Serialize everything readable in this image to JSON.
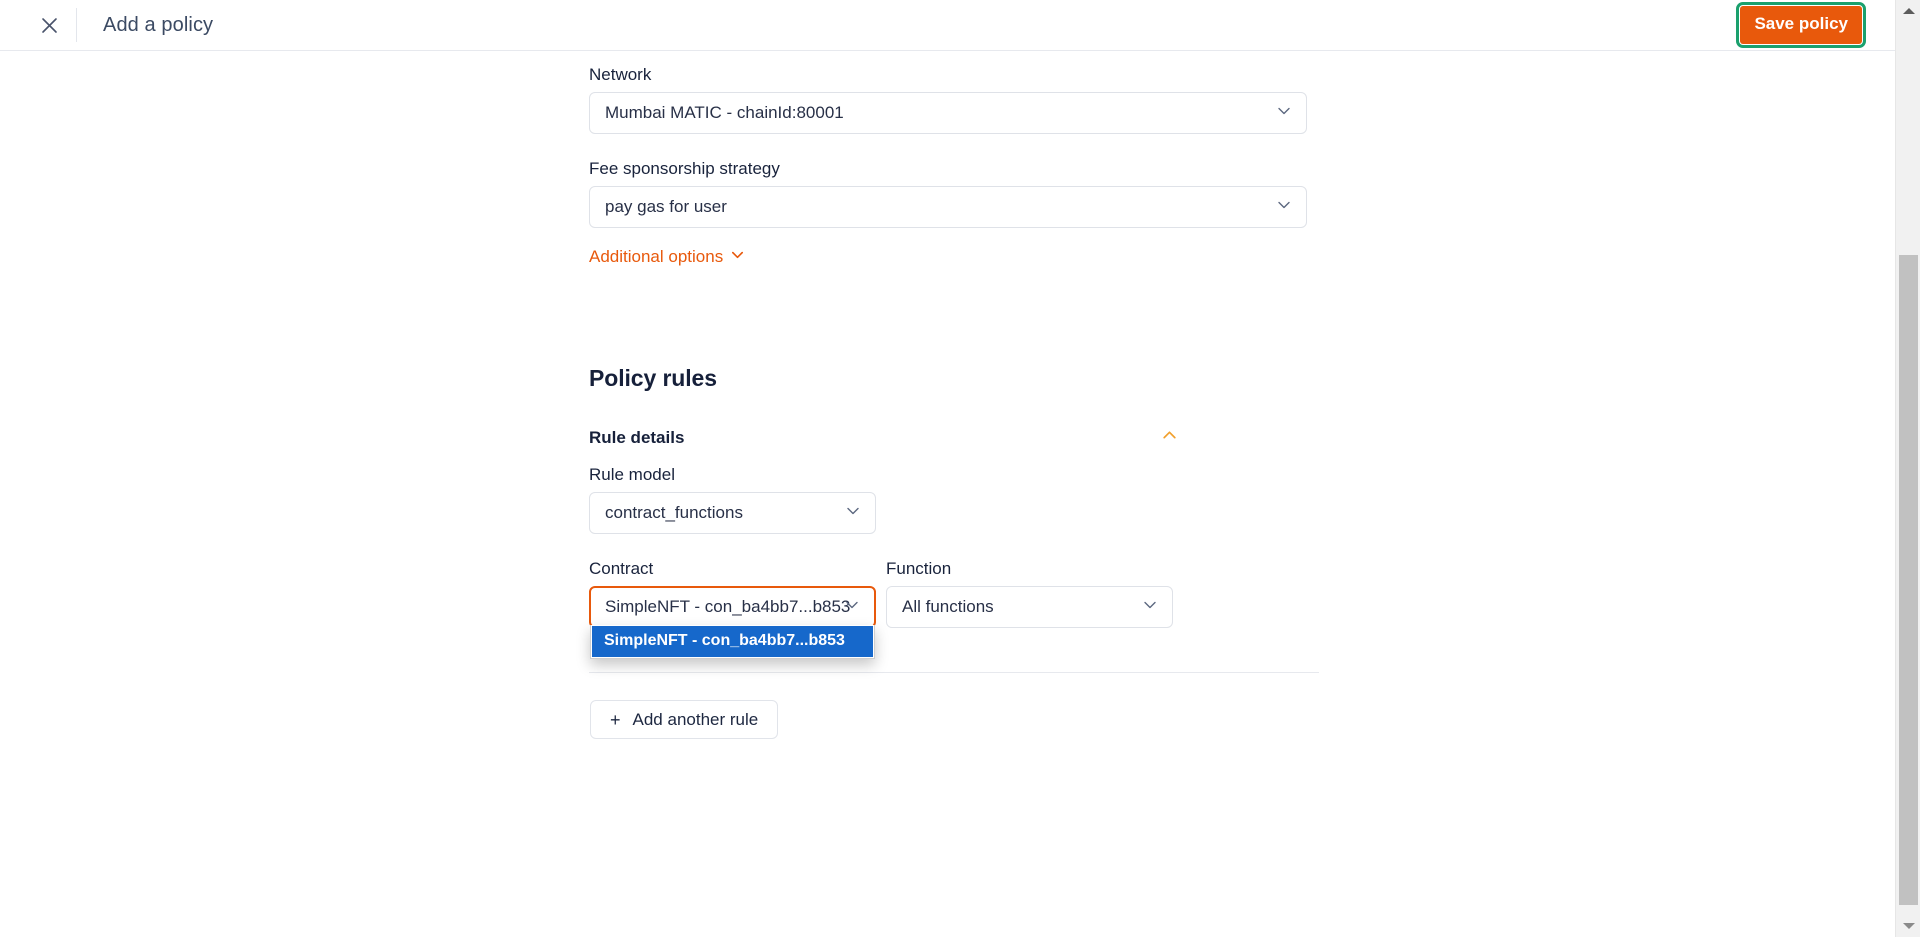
{
  "header": {
    "close_icon": "close-icon",
    "title": "Add a policy",
    "save_label": "Save policy",
    "accent_orange": "#e8590c",
    "focus_green": "#1aa06d"
  },
  "form": {
    "network": {
      "label": "Network",
      "value": "Mumbai MATIC - chainId:80001"
    },
    "fee_strategy": {
      "label": "Fee sponsorship strategy",
      "value": "pay gas for user"
    },
    "additional_options": {
      "label": "Additional options",
      "icon": "chevron-down-icon"
    }
  },
  "policy_rules": {
    "title": "Policy rules",
    "rule_details": {
      "label": "Rule details",
      "collapse_icon": "chevron-up-icon"
    },
    "rule_model": {
      "label": "Rule model",
      "value": "contract_functions"
    },
    "contract": {
      "label": "Contract",
      "value": "SimpleNFT - con_ba4bb7...b853",
      "focused": true,
      "open": true,
      "options": [
        "SimpleNFT - con_ba4bb7...b853"
      ],
      "highlighted_option": "SimpleNFT - con_ba4bb7...b853",
      "highlight_color": "#1668cb"
    },
    "function": {
      "label": "Function",
      "value": "All functions"
    },
    "add_another_rule": {
      "plus": "+",
      "label": "Add another rule"
    }
  },
  "scrollbar": {
    "up_arrow": "scroll-up-arrow",
    "down_arrow": "scroll-down-arrow"
  }
}
